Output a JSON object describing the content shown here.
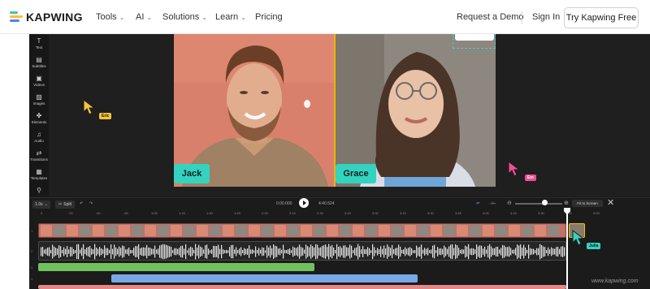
{
  "brand": {
    "name": "KAPWING",
    "logo_colors": [
      "#37c6b0",
      "#ffbf2f",
      "#4f82f1"
    ]
  },
  "nav": {
    "items": [
      {
        "label": "Tools",
        "has_menu": true
      },
      {
        "label": "AI",
        "has_menu": true
      },
      {
        "label": "Solutions",
        "has_menu": true
      },
      {
        "label": "Learn",
        "has_menu": true
      },
      {
        "label": "Pricing",
        "has_menu": false
      }
    ],
    "request_demo": "Request a Demo",
    "sign_in": "Sign In",
    "try_free": "Try Kapwing Free"
  },
  "sidebar": {
    "items": [
      {
        "label": "Text",
        "icon": "text-icon",
        "glyph": "T"
      },
      {
        "label": "Subtitles",
        "icon": "subtitles-icon",
        "glyph": "▤"
      },
      {
        "label": "Videos",
        "icon": "video-icon",
        "glyph": "▣"
      },
      {
        "label": "Images",
        "icon": "image-icon",
        "glyph": "▨"
      },
      {
        "label": "Elements",
        "icon": "elements-icon",
        "glyph": "✤"
      },
      {
        "label": "Audio",
        "icon": "audio-icon",
        "glyph": "♫"
      },
      {
        "label": "Transitions",
        "icon": "transitions-icon",
        "glyph": "⇄"
      },
      {
        "label": "Templates",
        "icon": "templates-icon",
        "glyph": "▦"
      },
      {
        "label": "",
        "icon": "plugin-icon",
        "glyph": "⚲"
      }
    ]
  },
  "canvas": {
    "panels": [
      {
        "name": "Jack",
        "tag_color": "#34d3c0"
      },
      {
        "name": "Grace",
        "tag_color": "#34d3c0"
      }
    ],
    "cursors": [
      {
        "label": "Eric",
        "color": "#f2c53d"
      },
      {
        "label": "Em",
        "color": "#f04e8f"
      },
      {
        "label": "Julia",
        "color": "#34d3c0"
      }
    ]
  },
  "timeline": {
    "speed": "1.0x",
    "split_label": "Split",
    "current_time": "0:00.000",
    "duration": "4:40.524",
    "fit_label": "Fit to Screen",
    "ruler": [
      "0",
      ":15",
      ":30",
      ":45",
      "1:00",
      "1:15",
      "1:30",
      "1:45",
      "2:00",
      "2:15",
      "2:30",
      "2:45",
      "3:00",
      "3:15",
      "3:30",
      "3:45",
      "4:00",
      "4:15",
      "4:30",
      "4:45",
      "5:00"
    ],
    "rows": [
      "1",
      "2",
      "3",
      "4"
    ]
  },
  "watermark": "www.kapwing.com"
}
